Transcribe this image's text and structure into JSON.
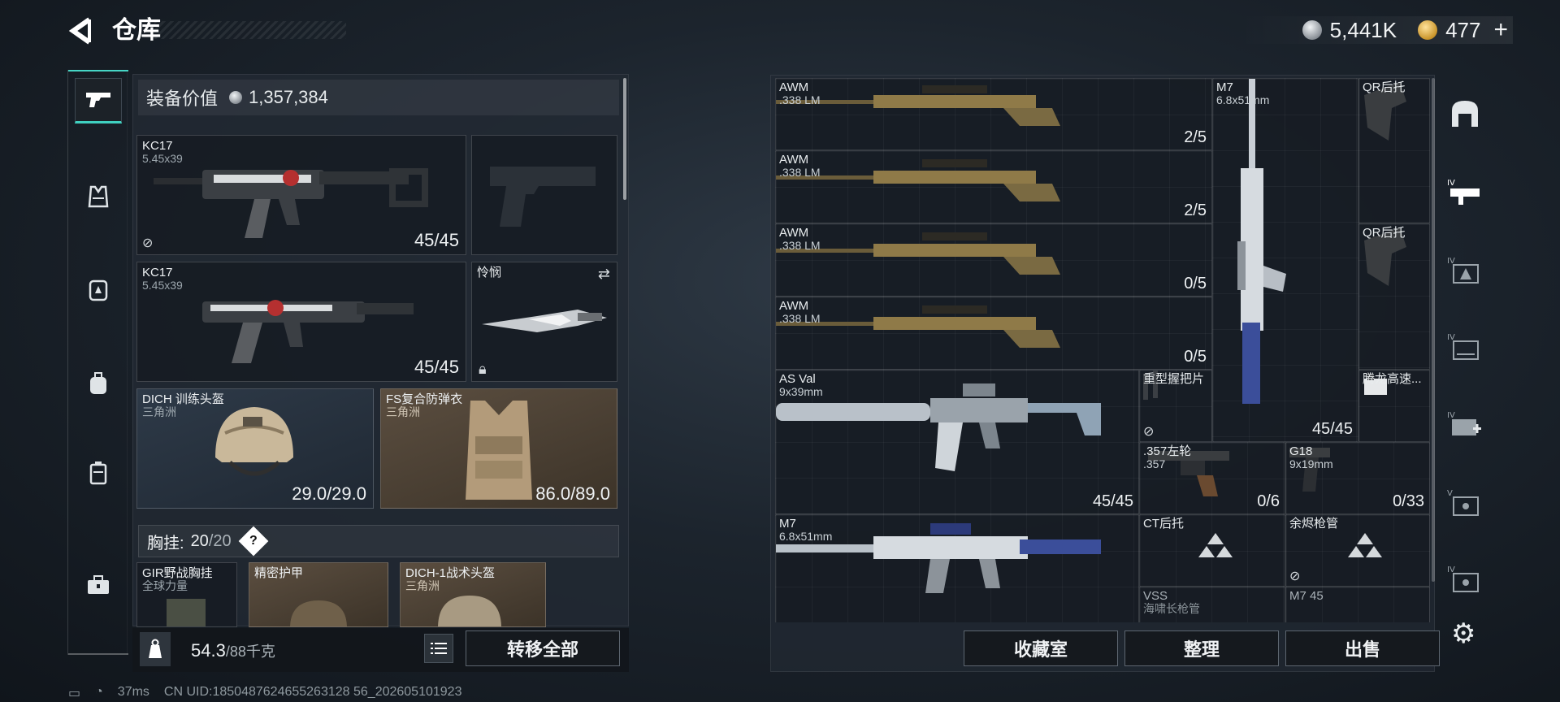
{
  "header": {
    "back_icon": "back-arrow-icon",
    "title": "仓库",
    "silver_value": "5,441K",
    "gold_value": "477",
    "gold_plus": "+"
  },
  "left_tabs": [
    "pistol-icon",
    "vest-icon",
    "backpack-rig-icon",
    "backpack-icon",
    "case-icon",
    "toolbox-icon"
  ],
  "equipment": {
    "label": "装备价值",
    "value": "1,357,384"
  },
  "slots": [
    {
      "name": "KC17",
      "sub": "5.45x39",
      "count": "45/45"
    },
    {
      "name": "KC17",
      "sub": "5.45x39",
      "count": "45/45"
    },
    {
      "name": "怜悯",
      "sub": "",
      "count": ""
    },
    {
      "name": "DICH 训练头盔",
      "sub": "三角洲",
      "count": "29.0/29.0"
    },
    {
      "name": "FS复合防弹衣",
      "sub": "三角洲",
      "count": "86.0/89.0"
    }
  ],
  "chest_rig": {
    "label": "胸挂:",
    "current": "20",
    "max": "20",
    "hint": "?"
  },
  "sub_slots": [
    {
      "name": "GIR野战胸挂",
      "sub": "全球力量"
    },
    {
      "name": "精密护甲",
      "sub": ""
    },
    {
      "name": "DICH-1战术头盔",
      "sub": "三角洲"
    }
  ],
  "bottom_left": {
    "weight": "54.3",
    "max": "/88千克",
    "kg_icon": "weight-icon",
    "list_icon": "list-icon",
    "transfer_all": "转移全部"
  },
  "right_items": [
    {
      "name": "AWM",
      "sub": ".338 LM",
      "count": "2/5"
    },
    {
      "name": "AWM",
      "sub": ".338 LM",
      "count": "2/5"
    },
    {
      "name": "AWM",
      "sub": ".338 LM",
      "count": "0/5"
    },
    {
      "name": "AWM",
      "sub": ".338 LM",
      "count": "0/5"
    },
    {
      "name": "M7",
      "sub": "6.8x51mm",
      "count": "45/45"
    },
    {
      "name": "QR后托",
      "sub": "",
      "count": ""
    },
    {
      "name": "QR后托",
      "sub": "",
      "count": ""
    },
    {
      "name": "AS Val",
      "sub": "9x39mm",
      "count": "45/45"
    },
    {
      "name": "重型握把片",
      "sub": "",
      "count": ""
    },
    {
      "name": "腾龙高速...",
      "sub": "",
      "count": ""
    },
    {
      "name": ".357左轮",
      "sub": ".357",
      "count": "0/6"
    },
    {
      "name": "G18",
      "sub": "9x19mm",
      "count": "0/33"
    },
    {
      "name": "M7",
      "sub": "6.8x51mm",
      "count": ""
    },
    {
      "name": "CT后托",
      "sub": "",
      "count": ""
    },
    {
      "name": "余烬枪管",
      "sub": "",
      "count": ""
    },
    {
      "name": "VSS",
      "sub": "海啸长枪管",
      "count": ""
    },
    {
      "name": "M7 45",
      "sub": "",
      "count": ""
    }
  ],
  "right_tabs": [
    "helmet-frame-icon",
    "weapon-iv-icon",
    "triangle-iv-icon",
    "box-iv-icon",
    "medkit-iv-icon",
    "case-v-icon",
    "case-iv-icon"
  ],
  "bottom_right": {
    "collection": "收藏室",
    "sort": "整理",
    "sell": "出售",
    "settings_icon": "gear-icon"
  },
  "status": {
    "ping": "37ms",
    "uid": "CN UID:1850487624655263128 56_202605101923"
  },
  "colors": {
    "accent": "#3fd0c0",
    "gold": "#c9942a",
    "brown_slot": "#5b4e40"
  }
}
